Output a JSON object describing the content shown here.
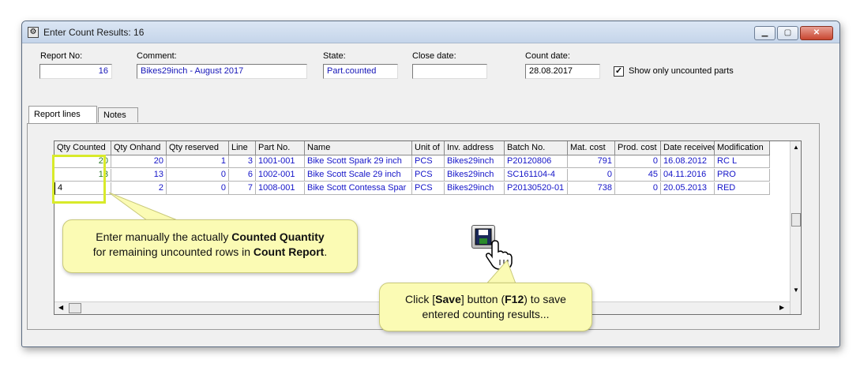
{
  "window": {
    "title": "Enter Count Results: 16",
    "controls": [
      "minimize",
      "maximize",
      "close"
    ]
  },
  "header": {
    "report_no_label": "Report No:",
    "report_no_value": "16",
    "comment_label": "Comment:",
    "comment_value": "Bikes29inch - August 2017",
    "state_label": "State:",
    "state_value": "Part.counted",
    "close_date_label": "Close date:",
    "close_date_value": "",
    "count_date_label": "Count date:",
    "count_date_value": "28.08.2017",
    "show_uncounted_label": "Show only uncounted parts",
    "show_uncounted_checked": true
  },
  "tabs": [
    "Report lines",
    "Notes"
  ],
  "table": {
    "columns": [
      "Qty Counted",
      "Qty Onhand",
      "Qty reserved",
      "Line",
      "Part No.",
      "Name",
      "Unit of",
      "Inv. address",
      "Batch No.",
      "Mat. cost",
      "Prod. cost",
      "Date received",
      "Modification"
    ],
    "rows": [
      [
        "20",
        "20",
        "1",
        "3",
        "1001-001",
        "Bike Scott Spark 29 inch",
        "PCS",
        "Bikes29inch",
        "P20120806",
        "791",
        "0",
        "16.08.2012",
        "RC L"
      ],
      [
        "13",
        "13",
        "0",
        "6",
        "1002-001",
        "Bike Scott Scale 29 inch",
        "PCS",
        "Bikes29inch",
        "SC161104-4",
        "0",
        "45",
        "04.11.2016",
        "PRO"
      ],
      [
        "4",
        "2",
        "0",
        "7",
        "1008-001",
        "Bike Scott Contessa Spar",
        "PCS",
        "Bikes29inch",
        "P20130520-01",
        "738",
        "0",
        "20.05.2013",
        "RED"
      ]
    ]
  },
  "callouts": {
    "enter_qty": {
      "line1_pre": "Enter manually the actually ",
      "line1_bold": "Counted Quantity",
      "line2_pre": "for remaining uncounted rows in ",
      "line2_bold": "Count Report",
      "line2_post": "."
    },
    "save": {
      "line1_pre": "Click [",
      "line1_bold1": "Save",
      "line1_mid": "] button (",
      "line1_bold2": "F12",
      "line1_post": ") to save",
      "line2": "entered counting results..."
    }
  },
  "icons": {
    "window_icon": "settings-icon",
    "save": "save-icon",
    "cursor": "hand-pointer-icon"
  },
  "colors": {
    "value_text": "#1414c8",
    "counted_text": "#2a7a2a",
    "highlight": "#d8ea2a",
    "callout_bg": "#fbfbb4"
  }
}
